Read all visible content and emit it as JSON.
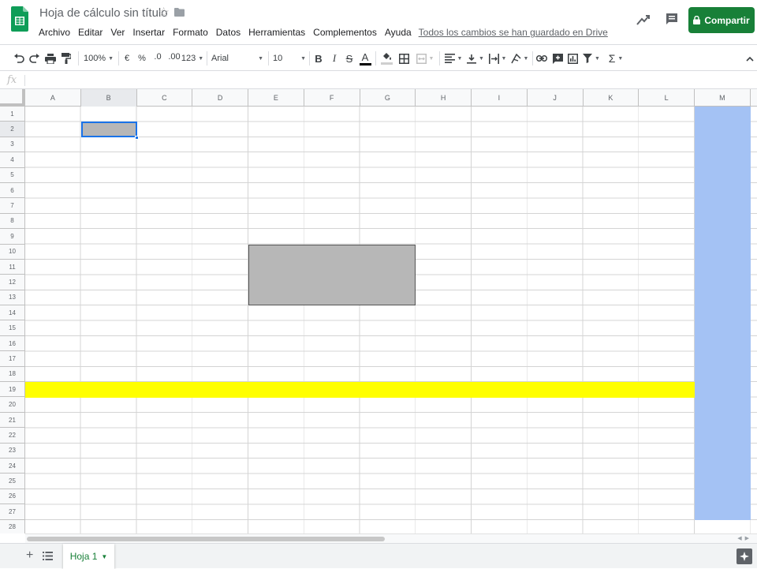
{
  "header": {
    "doc_title": "Hoja de cálculo sin título",
    "star_icon": "star-outline-icon",
    "folder_icon": "folder-icon",
    "menu": [
      "Archivo",
      "Editar",
      "Ver",
      "Insertar",
      "Formato",
      "Datos",
      "Herramientas",
      "Complementos",
      "Ayuda"
    ],
    "save_status": "Todos los cambios se han guardado en Drive",
    "share_label": "Compartir",
    "share_color": "#188038"
  },
  "toolbar": {
    "zoom": "100%",
    "currency": "€",
    "percent": "%",
    "decimal_decrease": ".0",
    "decimal_increase": ".00",
    "more_formats": "123",
    "font": "Arial",
    "font_size": "10",
    "bold": "B",
    "italic": "I",
    "strike": "S",
    "text_color": "A",
    "sum": "Σ"
  },
  "formula_bar": {
    "label": "fx",
    "value": ""
  },
  "grid": {
    "columns": [
      "A",
      "B",
      "C",
      "D",
      "E",
      "F",
      "G",
      "H",
      "I",
      "J",
      "K",
      "L",
      "M"
    ],
    "rows": [
      "1",
      "2",
      "3",
      "4",
      "5",
      "6",
      "7",
      "8",
      "9",
      "10",
      "11",
      "12",
      "13",
      "14",
      "15",
      "16",
      "17",
      "18",
      "19",
      "20",
      "21",
      "22",
      "23",
      "24",
      "25",
      "26",
      "27",
      "28"
    ],
    "active_cell": "B2",
    "fills": {
      "yellow_row": 19,
      "yellow_color": "#ffff00",
      "blue_column": "M",
      "blue_color": "#a4c2f4",
      "gray_range": "E10:G13",
      "gray_color": "#b7b7b7"
    }
  },
  "sheets": {
    "tabs": [
      "Hoja 1"
    ],
    "active": "Hoja 1"
  }
}
